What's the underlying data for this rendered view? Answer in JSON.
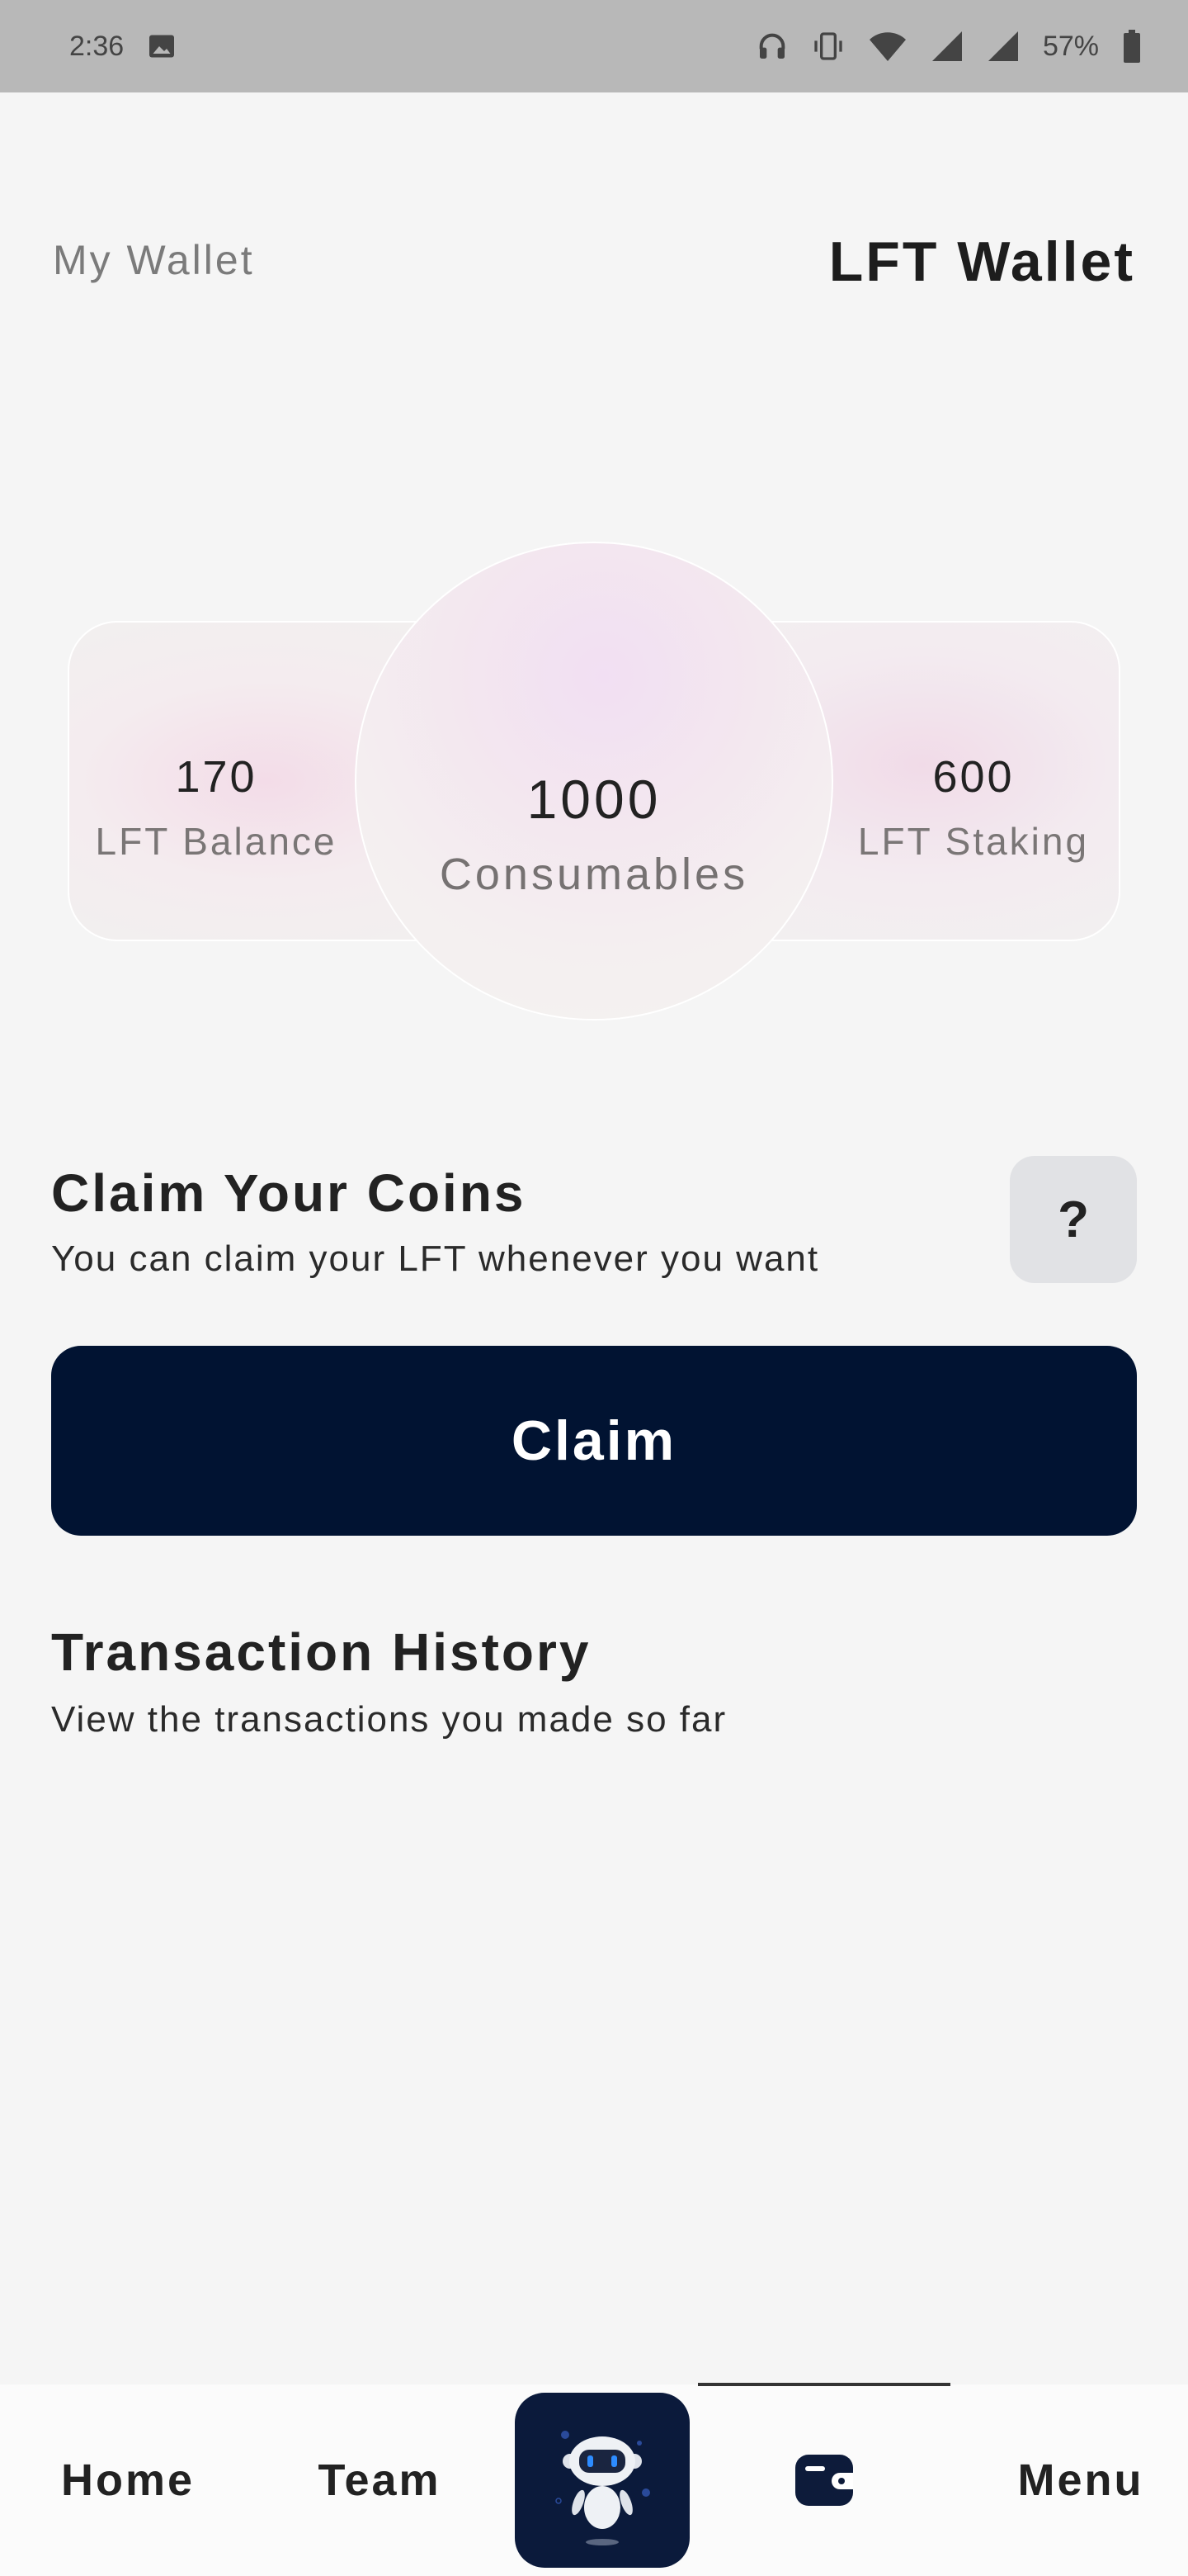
{
  "status_bar": {
    "time": "2:36",
    "battery": "57%",
    "icons": [
      "image-icon",
      "headphones-icon",
      "vibrate-icon",
      "wifi-icon",
      "signal-icon",
      "signal-icon",
      "battery-icon"
    ]
  },
  "header": {
    "left_title": "My Wallet",
    "right_title": "LFT Wallet"
  },
  "balances": {
    "left": {
      "value": "170",
      "label": "LFT Balance"
    },
    "center": {
      "value": "1000",
      "label": "Consumables"
    },
    "right": {
      "value": "600",
      "label": "LFT Staking"
    }
  },
  "claim_section": {
    "title": "Claim Your Coins",
    "subtitle": "You can claim your LFT whenever you want",
    "help_label": "?",
    "button_label": "Claim"
  },
  "history_section": {
    "title": "Transaction History",
    "subtitle": "View the transactions you made so far"
  },
  "bottom_nav": {
    "items": [
      {
        "label": "Home"
      },
      {
        "label": "Team"
      },
      {
        "icon": "robot-icon"
      },
      {
        "icon": "wallet-icon",
        "active": true
      },
      {
        "label": "Menu"
      }
    ]
  },
  "colors": {
    "background": "#f5f5f5",
    "primary": "#011332",
    "help_button": "#e1e2e5",
    "status_bar": "#b8b8b8"
  }
}
